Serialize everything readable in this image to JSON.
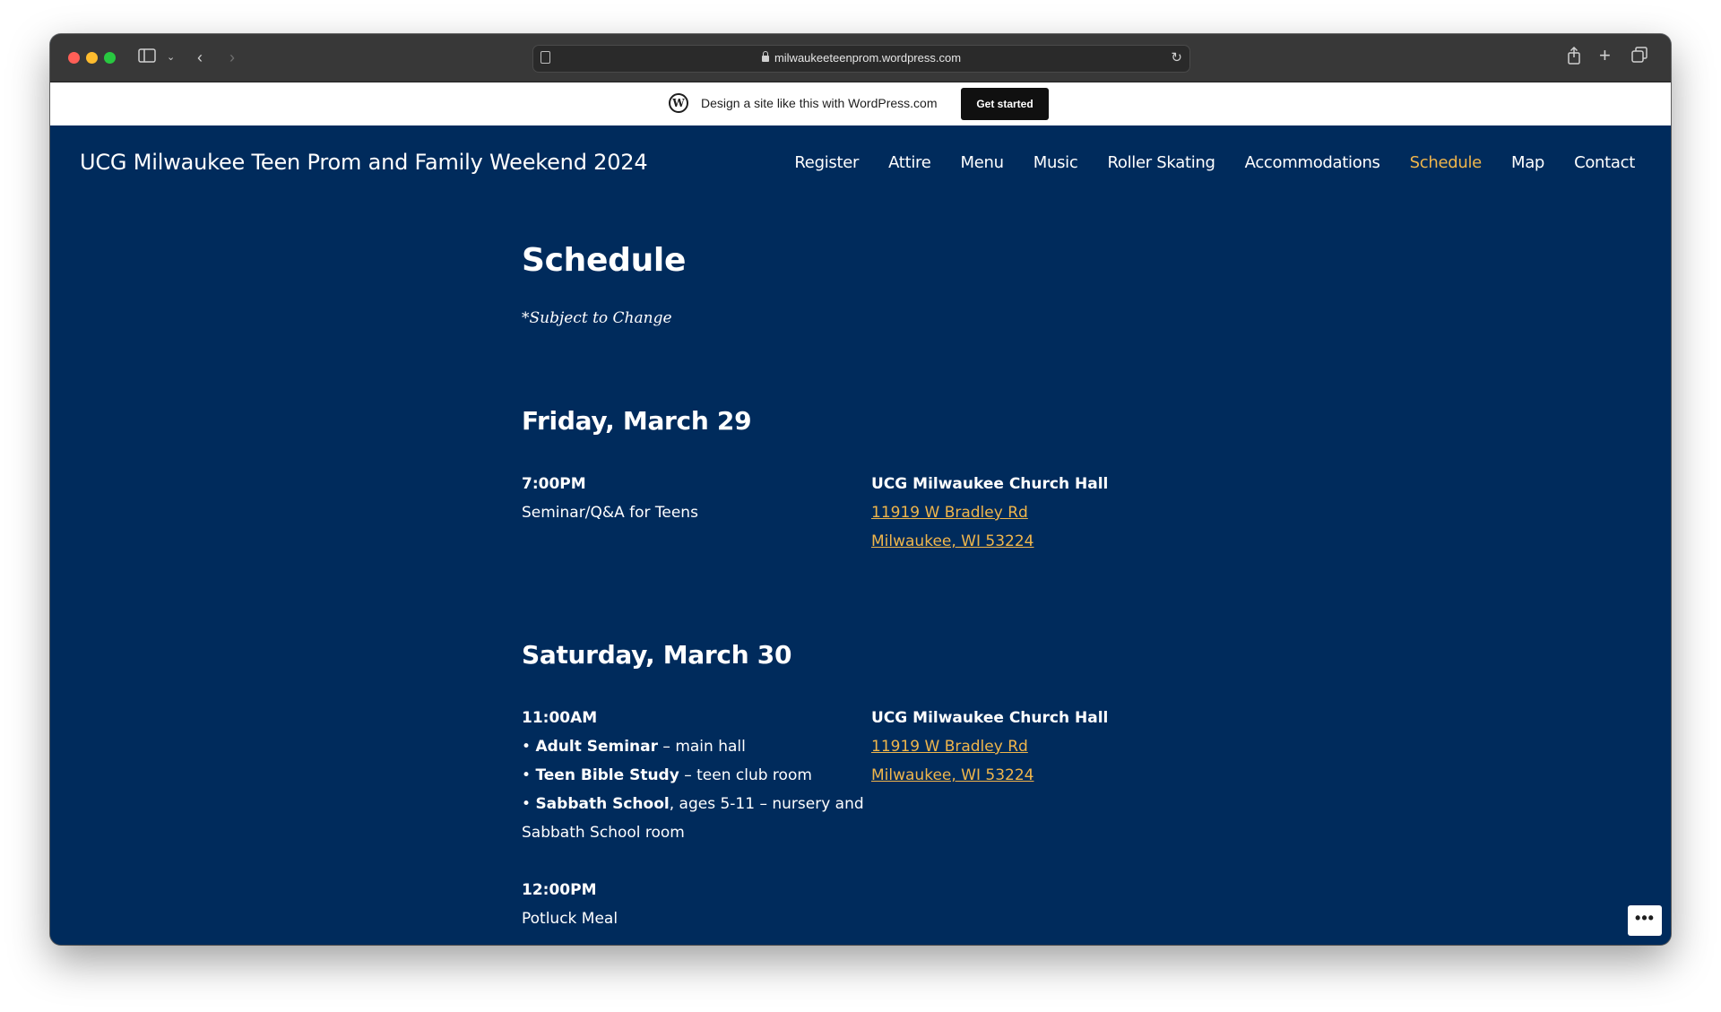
{
  "browser": {
    "url": "milwaukeeteenprom.wordpress.com"
  },
  "wp_banner": {
    "text": "Design a site like this with WordPress.com",
    "button": "Get started"
  },
  "site": {
    "title": "UCG Milwaukee Teen Prom and Family Weekend 2024",
    "nav": [
      {
        "label": "Register"
      },
      {
        "label": "Attire"
      },
      {
        "label": "Menu"
      },
      {
        "label": "Music"
      },
      {
        "label": "Roller Skating"
      },
      {
        "label": "Accommodations"
      },
      {
        "label": "Schedule",
        "active": true
      },
      {
        "label": "Map"
      },
      {
        "label": "Contact"
      }
    ],
    "accent_color": "#f0b64b",
    "background_color": "#002b5c"
  },
  "page": {
    "title": "Schedule",
    "note": "*Subject to Change",
    "days": [
      {
        "title": "Friday, March 29",
        "events": [
          {
            "time": "7:00PM",
            "description": "Seminar/Q&A for Teens",
            "venue": "UCG Milwaukee Church Hall",
            "address1": "11919 W Bradley Rd",
            "address2": "Milwaukee, WI 53224"
          }
        ]
      },
      {
        "title": "Saturday, March 30",
        "events": [
          {
            "time": "11:00AM",
            "items": [
              {
                "bullet": "•",
                "bold": "Adult Seminar",
                "rest": " – main hall"
              },
              {
                "bullet": "•",
                "bold": "Teen Bible Study",
                "rest": " – teen club room"
              },
              {
                "bullet": "•",
                "bold": "Sabbath School",
                "rest": ", ages 5-11 – nursery and Sabbath School room"
              }
            ],
            "venue": "UCG Milwaukee Church Hall",
            "address1": "11919 W Bradley Rd",
            "address2": "Milwaukee, WI 53224"
          },
          {
            "time": "12:00PM",
            "description": "Potluck Meal"
          }
        ]
      }
    ]
  },
  "more_button": "•••"
}
